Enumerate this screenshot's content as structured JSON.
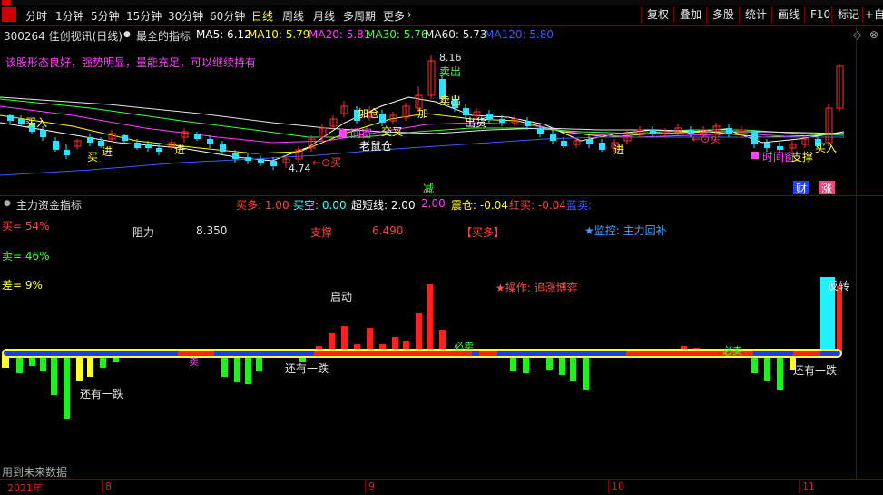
{
  "toolbar": {
    "periods": [
      "分时",
      "1分钟",
      "5分钟",
      "15分钟",
      "30分钟",
      "60分钟",
      "日线",
      "周线",
      "月线",
      "多周期",
      "更多"
    ],
    "active_period": "日线",
    "buttons": [
      "复权",
      "叠加",
      "多股",
      "统计",
      "画线",
      "F10",
      "标记",
      "+自"
    ]
  },
  "stock": {
    "header": "300264 佳创视讯(日线)",
    "indicator_name": "最全的指标",
    "ma": [
      {
        "label": "MA5: 6.12",
        "color": "#ffffff"
      },
      {
        "label": "MA10: 5.79",
        "color": "#ffff00"
      },
      {
        "label": "MA20: 5.81",
        "color": "#ff40ff"
      },
      {
        "label": "MA30: 5.76",
        "color": "#40ff40"
      },
      {
        "label": "MA60: 5.73",
        "color": "#e6e6e6"
      },
      {
        "label": "MA120: 5.80",
        "color": "#3a5cff"
      }
    ],
    "commentary": "该股形态良好，强势明显，量能充足，可以继续持有",
    "peak_price": "8.16",
    "low_price": "4.74",
    "badges": {
      "jian": "减",
      "cai": "财",
      "zhang": "涨"
    },
    "markers": [
      "买入",
      "买",
      "进",
      "进",
      "←⊙买",
      "卖出",
      "加仓",
      "老鼠仓",
      "时间窗",
      "交叉",
      "出货",
      "←⊙买",
      "买入",
      "时间窗",
      "支撑",
      "卖出",
      "加",
      "进"
    ]
  },
  "sub": {
    "name": "主力资金指标",
    "values": [
      {
        "label": "买多: 1.00",
        "color": "#ff4040"
      },
      {
        "label": "买空: 0.00",
        "color": "#40ffff"
      },
      {
        "label": "超短线: 2.00",
        "color": "#ffffff"
      },
      {
        "label": "2.00",
        "color": "#ff40ff"
      },
      {
        "label": "震仓: -0.04",
        "color": "#ffff00"
      },
      {
        "label": "红买: -0.04",
        "color": "#ff4040"
      },
      {
        "label": "蓝卖:",
        "color": "#3a5cff"
      }
    ],
    "buy_pct": "买= 54%",
    "sell_pct": "卖= 46%",
    "diff_pct": "差= 9%",
    "resistance_label": "阻力",
    "resistance_value": "8.350",
    "support_label": "支撑",
    "support_value": "6.490",
    "signal": "【买多】",
    "monitor": "★监控: 主力回补",
    "operation": "★操作: 追涨博弈",
    "annotations": [
      "启动",
      "反转",
      "还有一跌",
      "还有一跌",
      "还有一跌",
      "卖",
      "必卖",
      "必卖"
    ],
    "future_note": "用到未来数据"
  },
  "time_axis": {
    "labels": [
      "2021年",
      "8",
      "9",
      "10",
      "11"
    ]
  },
  "colors": {
    "up": "#ff3030",
    "down": "#30e0ff",
    "axis_red": "#7a0000",
    "vol_green": "#22ee22",
    "vol_red": "#ff2020"
  }
}
